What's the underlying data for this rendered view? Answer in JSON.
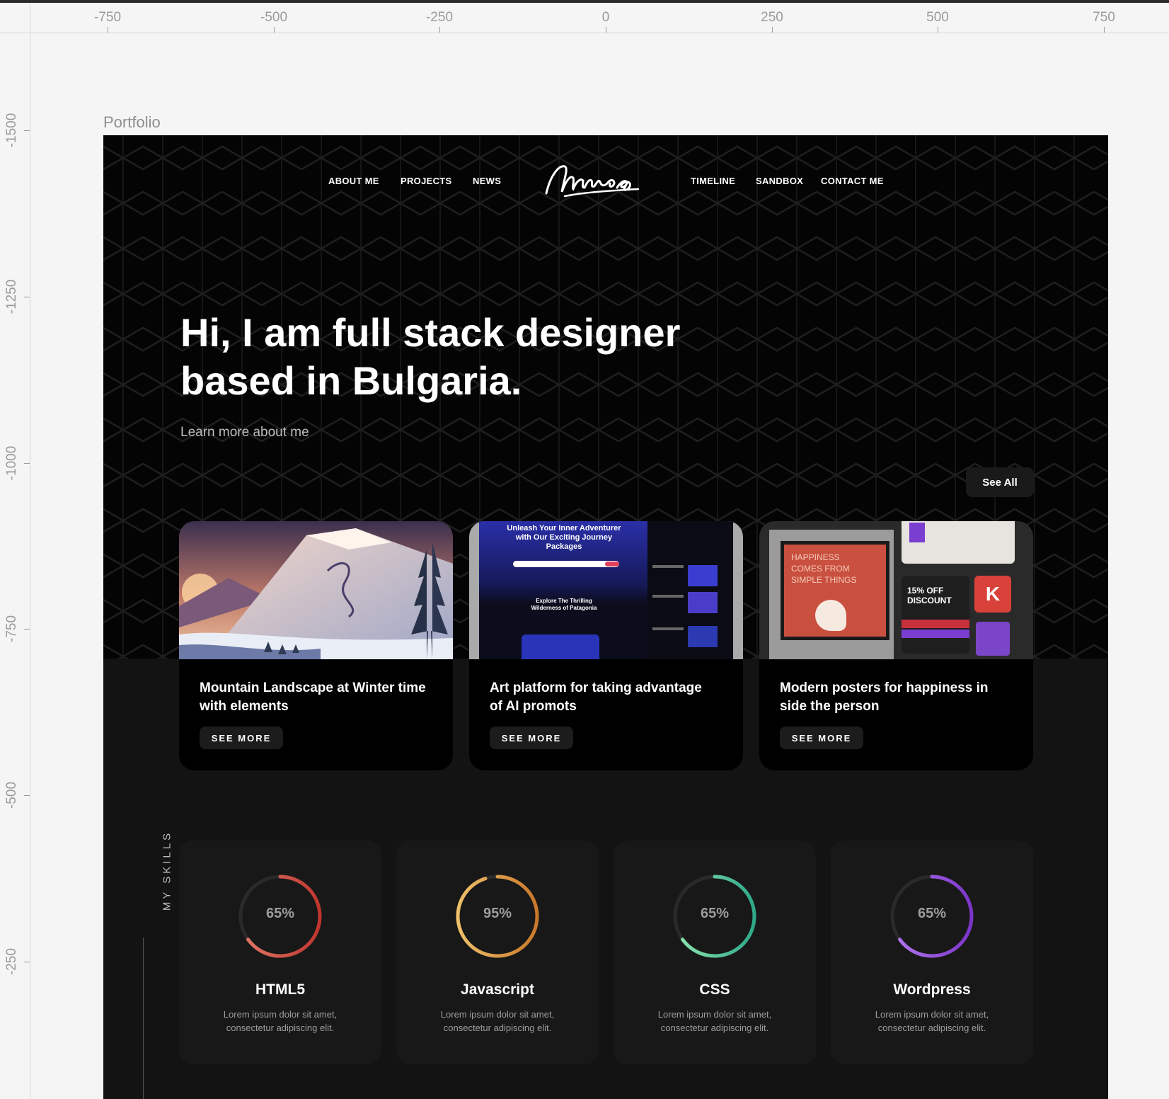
{
  "editor": {
    "frame_title": "Portfolio",
    "ruler_top": [
      "-750",
      "-500",
      "-250",
      "0",
      "250",
      "500",
      "750"
    ],
    "ruler_left": [
      "-1500",
      "-1250",
      "-1000",
      "-750",
      "-500",
      "-250"
    ]
  },
  "nav": {
    "about": "ABOUT ME",
    "projects": "PROJECTS",
    "news": "NEWS",
    "timeline": "TIMELINE",
    "sandbox": "SANDBOX",
    "contact": "CONTACT ME",
    "logo_text": "Amrios"
  },
  "hero": {
    "headline": "Hi, I am full stack designer based in Bulgaria.",
    "link": "Learn more about me",
    "see_all": "See All"
  },
  "projects": [
    {
      "title": "Mountain Landscape at Winter time with elements",
      "button": "SEE MORE"
    },
    {
      "title": "Art platform for taking advantage of AI promots",
      "button": "SEE MORE",
      "screenshot": {
        "heading": "Unleash Your Inner Adventurer with Our Exciting Journey Packages",
        "subheading": "Explore The Thrilling Wilderness of Patagonia"
      }
    },
    {
      "title": "Modern posters for happiness in side the person",
      "button": "SEE MORE",
      "screenshot": {
        "poster": "HAPPINESS COMES FROM SIMPLE THINGS",
        "discount": "15% OFF DISCOUNT"
      }
    }
  ],
  "skills": {
    "label": "MY SKILLS",
    "items": [
      {
        "name": "HTML5",
        "percent": "65%",
        "value": 65,
        "desc": "Lorem ipsum dolor sit amet, consectetur adipiscing elit.",
        "color_start": "#e07a6a",
        "color_end": "#c0352e"
      },
      {
        "name": "Javascript",
        "percent": "95%",
        "value": 95,
        "desc": "Lorem ipsum dolor sit amet, consectetur adipiscing elit.",
        "color_start": "#efc06a",
        "color_end": "#c9782a"
      },
      {
        "name": "CSS",
        "percent": "65%",
        "value": 65,
        "desc": "Lorem ipsum dolor sit amet, consectetur adipiscing elit.",
        "color_start": "#8fe6b0",
        "color_end": "#2fa88a"
      },
      {
        "name": "Wordpress",
        "percent": "65%",
        "value": 65,
        "desc": "Lorem ipsum dolor sit amet, consectetur adipiscing elit.",
        "color_start": "#b479f0",
        "color_end": "#7a35c8"
      }
    ]
  }
}
